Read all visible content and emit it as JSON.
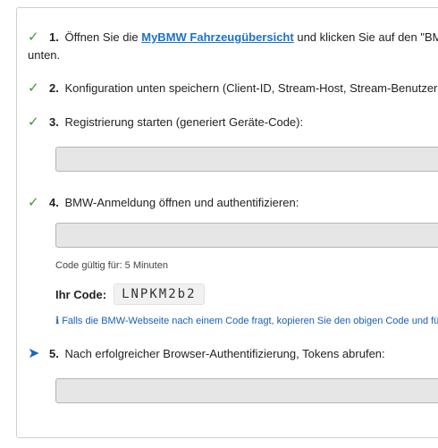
{
  "steps": [
    {
      "number": "1.",
      "text_before": "Öffnen Sie die",
      "link": "MyBMW Fahrzeugübersicht",
      "text_after": "und klicken Sie auf den \"BMW CarData\"-Tab. Scrollen Sie nach",
      "text_wrap": "unten."
    },
    {
      "number": "2.",
      "text": "Konfiguration unten speichern (Client-ID, Stream-Host, Stream-Benutzername):"
    },
    {
      "number": "3.",
      "text": "Registrierung starten (generiert Geräte-Code):"
    },
    {
      "number": "4.",
      "text": "BMW-Anmeldung öffnen und authentifizieren:"
    },
    {
      "number": "5.",
      "text": "Nach erfolgreicher Browser-Authentifizierung, Tokens abrufen:"
    }
  ],
  "marks": {
    "done": "✓",
    "active": "➤"
  },
  "code": {
    "validity": "Code gültig für: 5 Minuten",
    "label": "Ihr Code:",
    "value": "LNPKM2b2"
  },
  "info": {
    "icon": "ℹ",
    "text": "Falls die BMW-Webseite nach einem Code fragt, kopieren Sie den obigen Code und fügen ihn ein."
  },
  "colors": {
    "check": "#3a9a3a",
    "arrow": "#1766c6",
    "link": "#1a73c9",
    "button_bg": "#e6e6e6"
  }
}
